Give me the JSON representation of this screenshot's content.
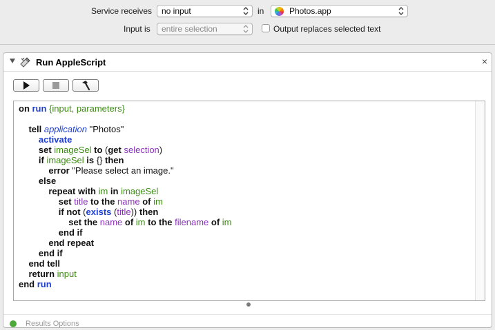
{
  "service": {
    "receives_label": "Service receives",
    "receives_value": "no input",
    "in_label": "in",
    "app_value": "Photos.app",
    "input_is_label": "Input is",
    "input_is_value": "entire selection",
    "output_replaces_label": "Output replaces selected text",
    "output_replaces_checked": false
  },
  "action": {
    "title": "Run AppleScript",
    "close": "×",
    "toolbar": {
      "run_icon": "play-icon",
      "stop_icon": "stop-icon",
      "compile_icon": "hammer-icon"
    },
    "script_lines": [
      [
        [
          "kw",
          "on "
        ],
        [
          "kwb",
          "run "
        ],
        [
          "var",
          "{input, parameters}"
        ]
      ],
      [],
      [
        [
          "kw",
          "    tell "
        ],
        [
          "app",
          "application "
        ],
        [
          "txt",
          "\"Photos\""
        ]
      ],
      [
        [
          "kwb",
          "        activate"
        ]
      ],
      [
        [
          "kw",
          "        set "
        ],
        [
          "var",
          "imageSel "
        ],
        [
          "kw",
          "to "
        ],
        [
          "txt",
          "("
        ],
        [
          "kw",
          "get "
        ],
        [
          "prop",
          "selection"
        ],
        [
          "txt",
          ")"
        ]
      ],
      [
        [
          "kw",
          "        if "
        ],
        [
          "var",
          "imageSel "
        ],
        [
          "kw",
          "is "
        ],
        [
          "txt",
          "{} "
        ],
        [
          "kw",
          "then"
        ]
      ],
      [
        [
          "kw",
          "            error "
        ],
        [
          "txt",
          "\"Please select an image.\""
        ]
      ],
      [
        [
          "kw",
          "        else"
        ]
      ],
      [
        [
          "kw",
          "            repeat with "
        ],
        [
          "var",
          "im "
        ],
        [
          "kw",
          "in "
        ],
        [
          "var",
          "imageSel"
        ]
      ],
      [
        [
          "kw",
          "                set "
        ],
        [
          "prop",
          "title "
        ],
        [
          "kw",
          "to the "
        ],
        [
          "prop",
          "name "
        ],
        [
          "kw",
          "of "
        ],
        [
          "var",
          "im"
        ]
      ],
      [
        [
          "kw",
          "                if not "
        ],
        [
          "txt",
          "("
        ],
        [
          "kwb",
          "exists "
        ],
        [
          "txt",
          "("
        ],
        [
          "prop",
          "title"
        ],
        [
          "txt",
          ")) "
        ],
        [
          "kw",
          "then"
        ]
      ],
      [
        [
          "kw",
          "                    set the "
        ],
        [
          "prop",
          "name "
        ],
        [
          "kw",
          "of "
        ],
        [
          "var",
          "im "
        ],
        [
          "kw",
          "to the "
        ],
        [
          "prop",
          "filename "
        ],
        [
          "kw",
          "of "
        ],
        [
          "var",
          "im"
        ]
      ],
      [
        [
          "kw",
          "                end if"
        ]
      ],
      [
        [
          "kw",
          "            end repeat"
        ]
      ],
      [
        [
          "kw",
          "        end if"
        ]
      ],
      [
        [
          "kw",
          "    end tell"
        ]
      ],
      [
        [
          "kw",
          "    return "
        ],
        [
          "var",
          "input"
        ]
      ],
      [
        [
          "kw",
          "end "
        ],
        [
          "kwb",
          "run"
        ]
      ]
    ],
    "footer_label": "Results   Options"
  }
}
